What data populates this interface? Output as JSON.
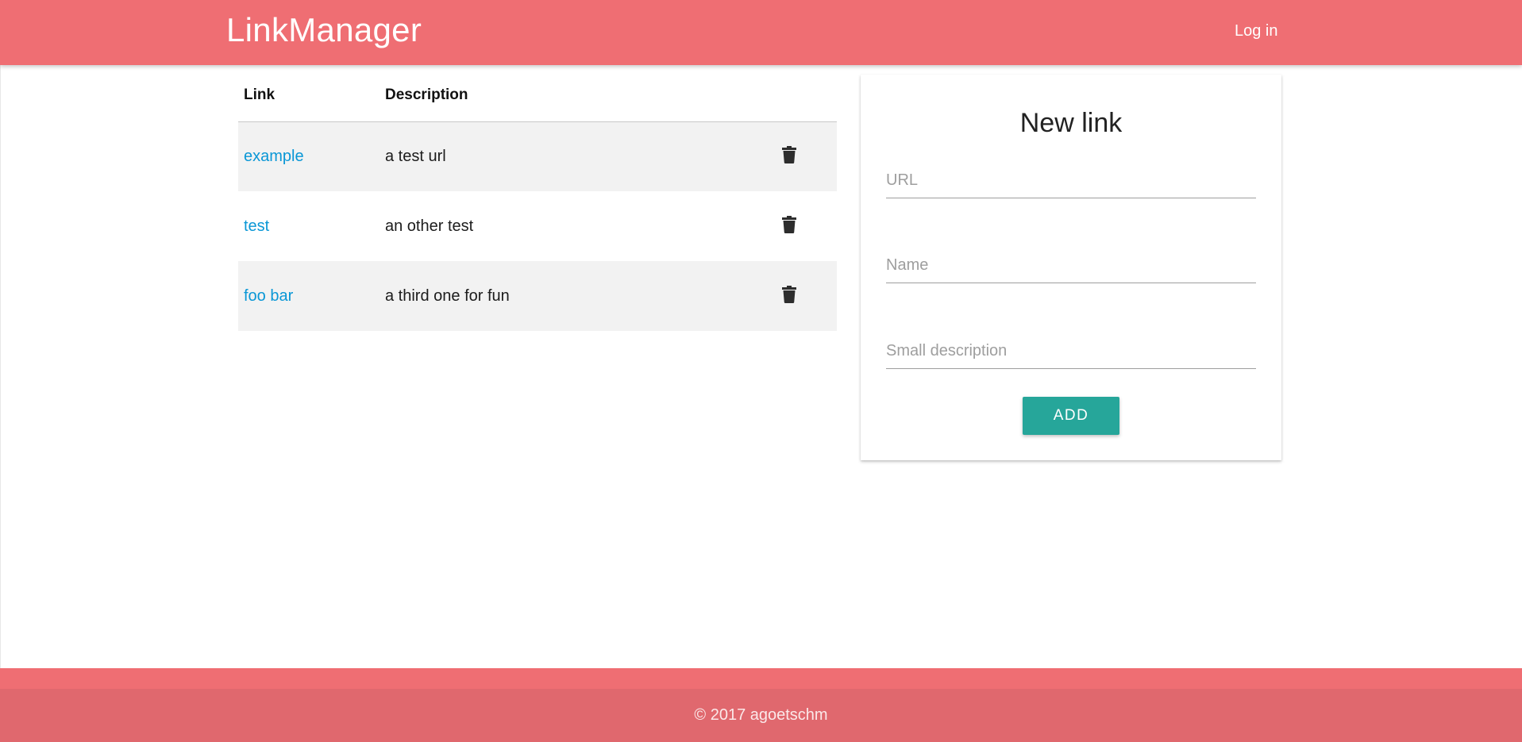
{
  "header": {
    "brand": "LinkManager",
    "login_label": "Log in",
    "accent_color": "#ef6e73"
  },
  "table": {
    "columns": [
      "Link",
      "Description"
    ],
    "rows": [
      {
        "link": "example",
        "description": "a test url",
        "action_icon": "trash-icon"
      },
      {
        "link": "test",
        "description": "an other test",
        "action_icon": "trash-icon"
      },
      {
        "link": "foo bar",
        "description": "a third one for fun",
        "action_icon": "trash-icon"
      }
    ],
    "link_color": "#0a97d6"
  },
  "form": {
    "title": "New link",
    "url_placeholder": "URL",
    "name_placeholder": "Name",
    "description_placeholder": "Small description",
    "url_value": "",
    "name_value": "",
    "description_value": "",
    "submit_label": "ADD",
    "button_color": "#26a69a"
  },
  "footer": {
    "copyright": "© 2017 agoetschm"
  }
}
